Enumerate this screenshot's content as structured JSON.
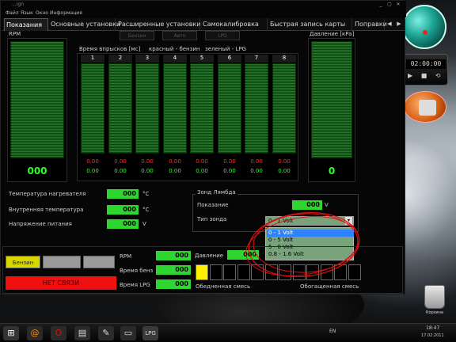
{
  "window": {
    "title": "...ign",
    "controls": [
      "_",
      "▢",
      "✕"
    ],
    "menu": [
      "Файл",
      "Язык",
      "Окно",
      "Информация"
    ]
  },
  "tabs": {
    "items": [
      "Показания",
      "Основные установки",
      "Расширенные установки",
      "Самокалибровка",
      "Быстрая запись карты",
      "Поправки"
    ],
    "active": "Показания",
    "nav_left": "◀",
    "nav_right": "▶"
  },
  "buttons_disabled": [
    "Бензин",
    "Авто",
    "LPG"
  ],
  "rpm": {
    "label": "RPM",
    "value": "000"
  },
  "injection": {
    "title": "Время впрысков [мс]",
    "legend_red": "красный - бензин",
    "legend_green": "зеленый - LPG",
    "channels": [
      {
        "n": "1",
        "petrol": "0.00",
        "lpg": "0.00"
      },
      {
        "n": "2",
        "petrol": "0.00",
        "lpg": "0.00"
      },
      {
        "n": "3",
        "petrol": "0.00",
        "lpg": "0.00"
      },
      {
        "n": "4",
        "petrol": "0.00",
        "lpg": "0.00"
      },
      {
        "n": "5",
        "petrol": "0.00",
        "lpg": "0.00"
      },
      {
        "n": "6",
        "petrol": "0.00",
        "lpg": "0.00"
      },
      {
        "n": "7",
        "petrol": "0.00",
        "lpg": "0.00"
      },
      {
        "n": "8",
        "petrol": "0.00",
        "lpg": "0.00"
      }
    ]
  },
  "pressure": {
    "label": "Давление [кPa]",
    "value": "0"
  },
  "readings": [
    {
      "label": "Температура нагревателя",
      "value": "000",
      "unit": "°C"
    },
    {
      "label": "Внутренняя температура",
      "value": "000",
      "unit": "°C"
    },
    {
      "label": "Напряжение питания",
      "value": "000",
      "unit": "V"
    }
  ],
  "lambda": {
    "title": "Зонд Лямбда",
    "reading_label": "Показание",
    "reading_value": "000",
    "reading_unit": "V",
    "type_label": "Тип зонда",
    "selected": "0 - 1 Volt",
    "options": [
      "0 - 1 Volt",
      "0 - 5 Volt",
      "5 - 0 Volt",
      "0.8 - 1.6 Volt"
    ]
  },
  "bottom": {
    "fuel_button": "Бензин",
    "alarm": "НЕТ СВЯЗИ",
    "rpm_label": "RPM",
    "rpm_value": "000",
    "petrol_time_label": "Время бенз",
    "petrol_time_value": "000",
    "lpg_time_label": "Время LPG",
    "lpg_time_value": "000",
    "pressure_label": "Давление",
    "pressure_value": "000",
    "lean_label": "Обедненная смесь",
    "rich_label": "Обогащенная смесь"
  },
  "desktop": {
    "timer": "02:00:00",
    "recycle_label": "Корзина"
  },
  "taskbar": {
    "lang": "EN",
    "clock": "18:47",
    "date": "17.02.2011"
  },
  "colors": {
    "gauge_green": "#0a8a12",
    "value_green": "#2bff2b",
    "alarm_red": "#f01010",
    "fuel_yellow": "#d7d700",
    "highlight_blue": "#2f82ff"
  }
}
